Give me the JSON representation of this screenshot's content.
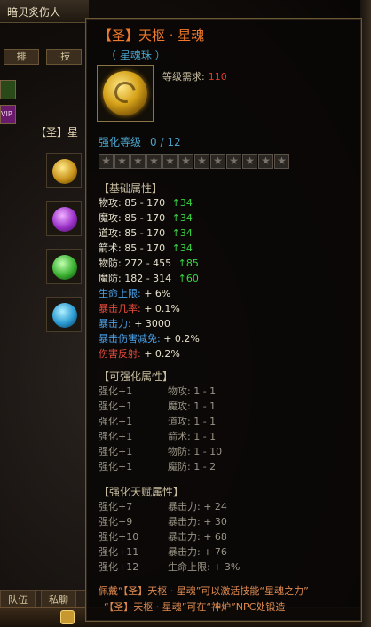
{
  "scene": {
    "window_title": "暗贝炙伤人",
    "tabs": [
      "排",
      "·技"
    ],
    "side_labels": [
      "【圣】星"
    ],
    "vip_label": "VIP",
    "bottom_buttons": [
      "队伍",
      "私聊"
    ]
  },
  "tooltip": {
    "title": "【圣】天枢 · 星魂",
    "subtitle": "（ 星魂珠 ）",
    "requirement_label": "等级需求:",
    "requirement_value": "110",
    "enhance_label": "强化等级",
    "enhance_value": "0 / 12",
    "star_count": 12,
    "base_title": "【基础属性】",
    "base_stats": [
      {
        "name": "物攻",
        "range": "85 - 170",
        "bonus": "34",
        "color": "w"
      },
      {
        "name": "魔攻",
        "range": "85 - 170",
        "bonus": "34",
        "color": "w"
      },
      {
        "name": "道攻",
        "range": "85 - 170",
        "bonus": "34",
        "color": "w"
      },
      {
        "name": "箭术",
        "range": "85 - 170",
        "bonus": "34",
        "color": "w"
      },
      {
        "name": "物防",
        "range": "272 - 455",
        "bonus": "85",
        "color": "w"
      },
      {
        "name": "魔防",
        "range": "182 - 314",
        "bonus": "60",
        "color": "w"
      }
    ],
    "special_stats": [
      {
        "text": "生命上限: + 6%",
        "color": "b"
      },
      {
        "text": "暴击几率: + 0.1%",
        "color": "r"
      },
      {
        "text": "暴击力: + 3000",
        "color": "b"
      },
      {
        "text": "暴击伤害减免: + 0.2%",
        "color": "b"
      },
      {
        "text": "伤害反射: + 0.2%",
        "color": "r"
      }
    ],
    "upgrade_title": "【可强化属性】",
    "upgrade_stats": [
      {
        "lvl": "强化+1",
        "text": "物攻: 1 - 1"
      },
      {
        "lvl": "强化+1",
        "text": "魔攻: 1 - 1"
      },
      {
        "lvl": "强化+1",
        "text": "道攻: 1 - 1"
      },
      {
        "lvl": "强化+1",
        "text": "箭术: 1 - 1"
      },
      {
        "lvl": "强化+1",
        "text": "物防: 1 - 10"
      },
      {
        "lvl": "强化+1",
        "text": "魔防: 1 - 2"
      }
    ],
    "talent_title": "【强化天赋属性】",
    "talent_stats": [
      {
        "lvl": "强化+7",
        "text": "暴击力: + 24"
      },
      {
        "lvl": "强化+9",
        "text": "暴击力: + 30"
      },
      {
        "lvl": "强化+10",
        "text": "暴击力: + 68"
      },
      {
        "lvl": "强化+11",
        "text": "暴击力: + 76"
      },
      {
        "lvl": "强化+12",
        "text": "生命上限: + 3%"
      }
    ],
    "footer_line1": "佩戴“【圣】天枢 · 星魂”可以激活技能“星魂之力”",
    "footer_line2": "“【圣】天枢 · 星魂”可在“神炉”NPC处锻造"
  },
  "colors": {
    "title": "#f07a2a",
    "blue": "#4aa0c8",
    "green": "#37d640",
    "red": "#e84a3a",
    "footer": "#e08a50"
  },
  "icons": [
    "orb-gold",
    "orb-purple",
    "orb-green",
    "orb-blue",
    "star-empty",
    "lock-icon",
    "up-arrow-icon"
  ]
}
